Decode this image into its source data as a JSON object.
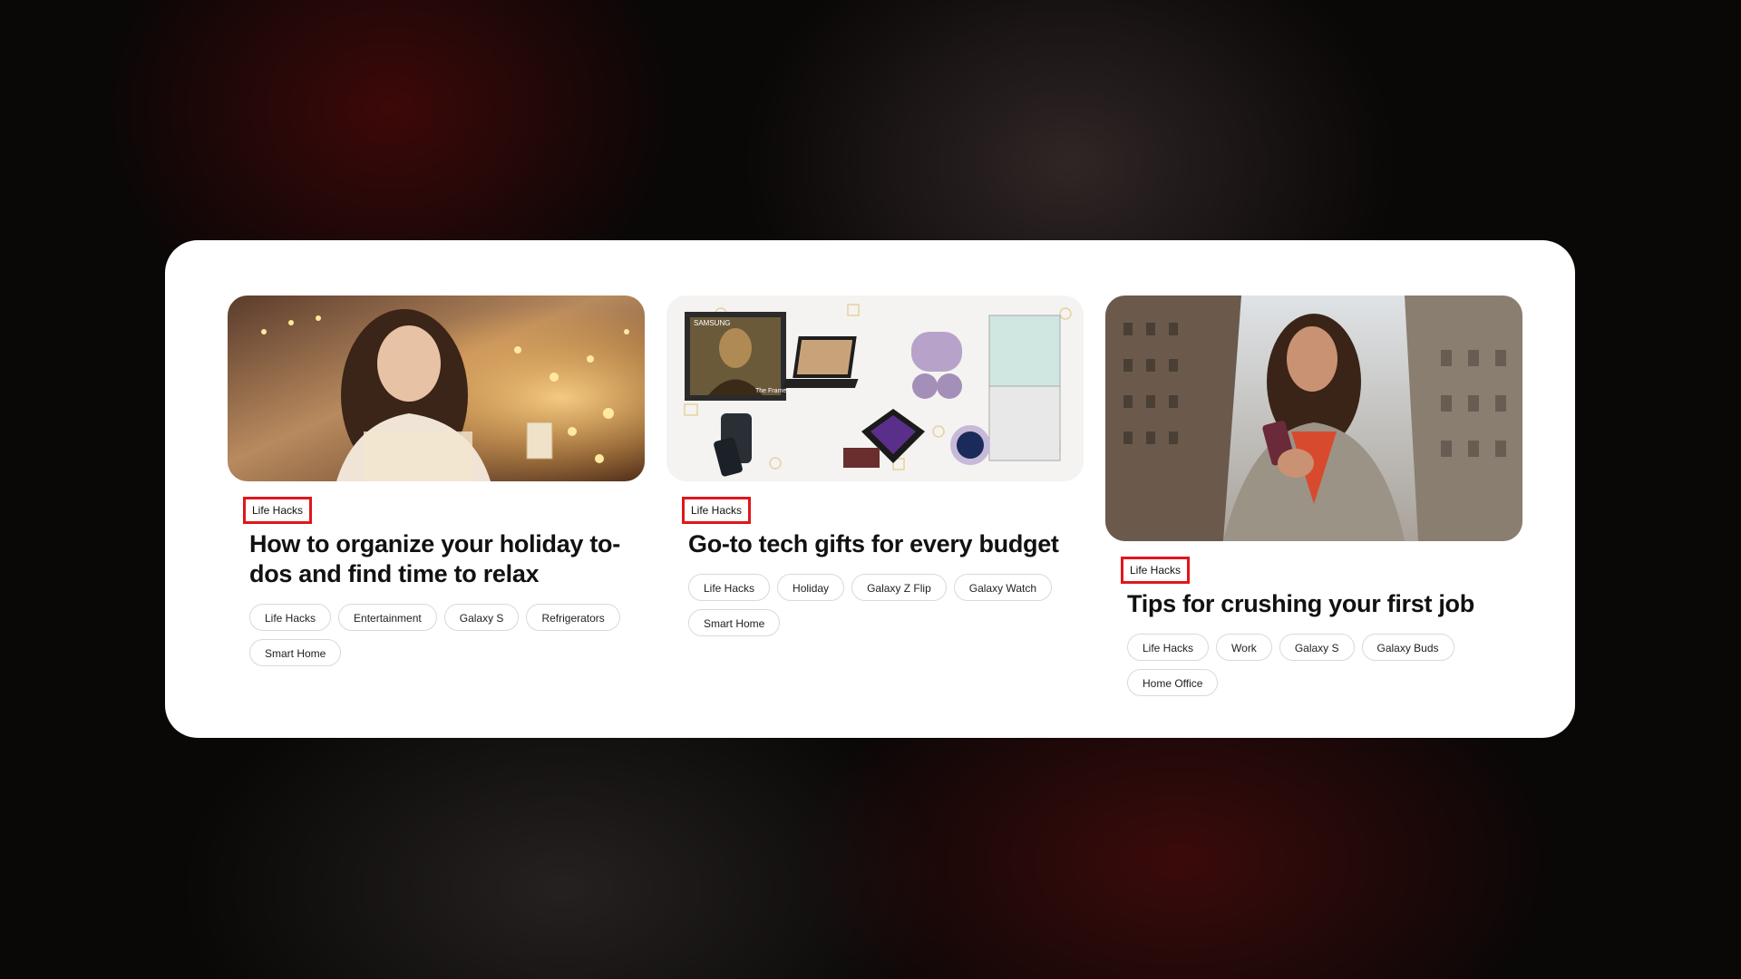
{
  "articles": [
    {
      "image_alt": "woman-with-holiday-lights-photo",
      "category": "Life Hacks",
      "title": "How to organize your holiday to-dos and find time to relax",
      "tags": [
        "Life Hacks",
        "Entertainment",
        "Galaxy S",
        "Refrigerators",
        "Smart Home"
      ]
    },
    {
      "image_alt": "tech-gifts-collage-photo",
      "category": "Life Hacks",
      "title": "Go-to tech gifts for every budget",
      "tags": [
        "Life Hacks",
        "Holiday",
        "Galaxy Z Flip",
        "Galaxy Watch",
        "Smart Home"
      ],
      "image_text": {
        "brand": "SAMSUNG",
        "frame": "The Frame"
      }
    },
    {
      "image_alt": "woman-with-phone-in-city-photo",
      "category": "Life Hacks",
      "title": "Tips for crushing your first job",
      "tags": [
        "Life Hacks",
        "Work",
        "Galaxy S",
        "Galaxy Buds",
        "Home Office"
      ]
    }
  ],
  "colors": {
    "highlight_border": "#e0161a",
    "panel_bg": "#ffffff",
    "page_bg": "#0a0707"
  }
}
